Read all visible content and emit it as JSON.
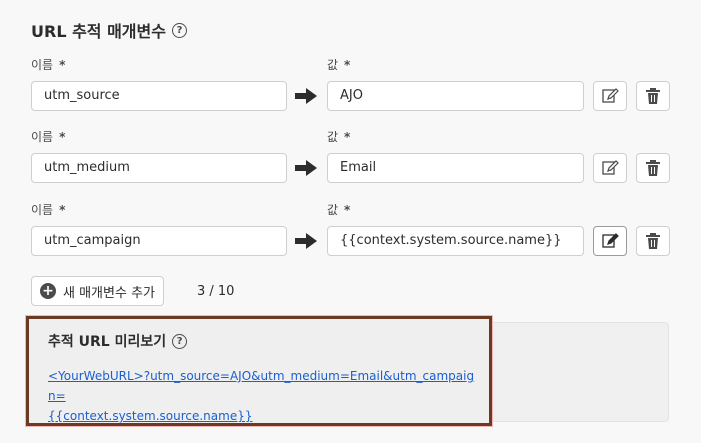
{
  "title": "URL 추적 매개변수",
  "help_symbol": "?",
  "required_mark": "*",
  "rows": [
    {
      "name_label": "이름",
      "name_value": "utm_source",
      "value_label": "값",
      "value_value": "AJO"
    },
    {
      "name_label": "이름",
      "name_value": "utm_medium",
      "value_label": "값",
      "value_value": "Email"
    },
    {
      "name_label": "이름",
      "name_value": "utm_campaign",
      "value_label": "값",
      "value_value": "{{context.system.source.name}}"
    }
  ],
  "add_button_label": "새 매개변수 추가",
  "counter": "3 / 10",
  "preview": {
    "title": "추적 URL 미리보기",
    "url_line1": "<YourWebURL>?utm_source=AJO&utm_medium=Email&utm_campaign=",
    "url_line2": "{{context.system.source.name}}"
  },
  "icons": {
    "help": "help-icon",
    "arrow": "arrow-right-icon",
    "edit": "edit-icon",
    "delete": "trash-icon",
    "add": "add-circle-icon"
  }
}
